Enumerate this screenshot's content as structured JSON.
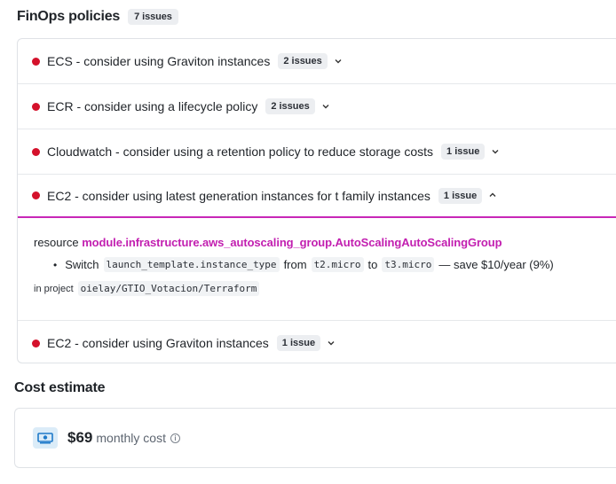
{
  "section": {
    "title": "FinOps policies",
    "count": "7 issues"
  },
  "policies": [
    {
      "label": "ECS - consider using Graviton instances",
      "badge": "2 issues",
      "expanded": false
    },
    {
      "label": "ECR - consider using a lifecycle policy",
      "badge": "2 issues",
      "expanded": false
    },
    {
      "label": "Cloudwatch - consider using a retention policy to reduce storage costs",
      "badge": "1 issue",
      "expanded": false
    },
    {
      "label": "EC2 - consider using latest generation instances for t family instances",
      "badge": "1 issue",
      "expanded": true
    },
    {
      "label": "EC2 - consider using Graviton instances",
      "badge": "1 issue",
      "expanded": false
    }
  ],
  "expanded_detail": {
    "resource_prefix": "resource",
    "resource_name": "module.infrastructure.aws_autoscaling_group.AutoScalingAutoScalingGroup",
    "bullet": "•",
    "switch_word": "Switch",
    "field": "launch_template.instance_type",
    "from_word": "from",
    "from_value": "t2.micro",
    "to_word": "to",
    "to_value": "t3.micro",
    "savings": "— save $10/year (9%)",
    "project_prefix": "in project",
    "project_path": "oielay/GTIO_Votacion/Terraform"
  },
  "cost": {
    "title": "Cost estimate",
    "amount": "$69",
    "label": "monthly cost",
    "info_glyph": "i"
  },
  "icons": {
    "chevron_down": "⌄",
    "chevron_up": "⌃"
  },
  "colors": {
    "status_red": "#d4112b",
    "accent_magenta": "#c827b7",
    "link_magenta": "#c21fb0",
    "money_icon_bg": "#dbecf8",
    "money_icon_fg": "#1f7ac9"
  }
}
